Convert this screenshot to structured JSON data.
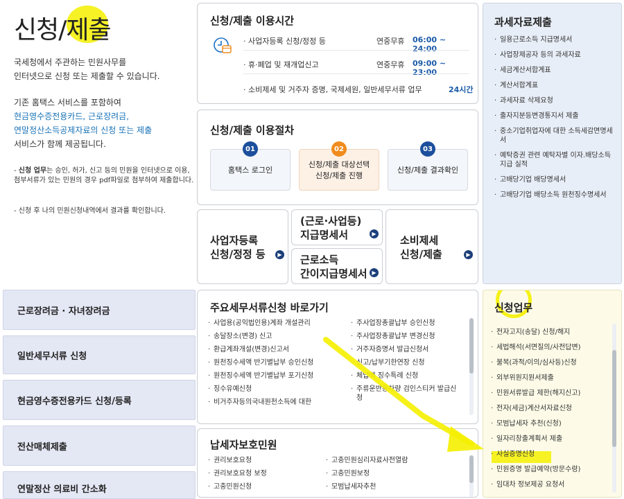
{
  "page_title": "신청/제출",
  "intro": {
    "line1": "국세청에서 주관하는 민원사무를",
    "line2": "인터넷으로 신청 또는 제출할 수 있습니다.",
    "line3": "기존 홈택스 서비스를 포함하여",
    "line4_blue": "현금영수증전용카드, 근로장려금,",
    "line5_blue": "연말정산소득공제자료의 신청 또는 제출",
    "line6": "서비스가 함께 제공됩니다."
  },
  "notes": {
    "note1_bold": "신청 업무",
    "note1_rest": "는 승인, 허가, 신고 등의 민원을 인터넷으로 이용, 첨부서류가 있는 민원의 경우 pdf파일로 첨부하여 제출합니다.",
    "note2": "- 신청 후 나의 민원신청내역에서 결과를 확인합니다."
  },
  "hours": {
    "title": "신청/제출 이용시간",
    "rows": [
      {
        "label": "· 사업자등록 신청/정정 등",
        "days": "연중무휴",
        "time": "06:00 ~ 24:00"
      },
      {
        "label": "· 휴·폐업 및 재개업신고",
        "days": "연중무휴",
        "time": "09:00 ~ 23:00"
      },
      {
        "label": "· 소비제세 및 거주자 증명, 국제세원, 일반세무서류 업무",
        "days": "",
        "time": "24시간"
      }
    ]
  },
  "procedure": {
    "title": "신청/제출 이용절차",
    "steps": [
      {
        "num": "01",
        "label": "홈택스 로그인"
      },
      {
        "num": "02",
        "label": "신청/제출 대상선택\n신청/제출 진행"
      },
      {
        "num": "03",
        "label": "신청/제출 결과확인"
      }
    ]
  },
  "shortcuts": {
    "biz_reg": "사업자등록\n신청/정정 등",
    "pay_stmt": "(근로·사업등)\n지급명세서",
    "simple_stmt": "근로소득\n간이지급명세서",
    "consumption": "소비제세\n신청/제출"
  },
  "tax_submit": {
    "title": "과세자료제출",
    "items": [
      "일용근로소득 지급명세서",
      "사업장제공자 등의 과세자료",
      "세금계산서합계표",
      "계산서합계표",
      "과세자료 삭제요청",
      "출자지분등변경통지서 제출",
      "중소기업취업자에 대한 소득세감면명세서",
      "예탁증권 관련 예탁자별 이자.배당소득 지급 실적",
      "고배당기업 배당명세서",
      "고배당기업 배당소득 원천징수명세서"
    ]
  },
  "side_buttons": [
    "근로장려금 · 자녀장려금",
    "일반세무서류 신청",
    "현금영수증전용카드 신청/등록",
    "전산매체제출",
    "연말정산 의료비 간소화"
  ],
  "main_docs": {
    "title": "주요세무서류신청 바로가기",
    "col1": [
      "사업용(공익법인용)계좌 개설관리",
      "송달장소(변경) 신고",
      "환급계좌개설(변경)신고서",
      "원천징수세액 반기별납부 승인신청",
      "원천징수세액 반기별납부 포기신청",
      "징수유예신청",
      "비거주자등의국내원천소득에 대한"
    ],
    "col2": [
      "주사업장총괄납부 승인신청",
      "주사업장총괄납부 변경신청",
      "거주자증명서 발급신청서",
      "신고/납부기한연장 신청",
      "체납액 징수특례 신청",
      "주류운반용차량 검인스티커 발급신청"
    ]
  },
  "protection": {
    "title": "납세자보호민원",
    "col1": [
      "권리보호요청",
      "권리보호요청 보정",
      "고충민원신청"
    ],
    "col2": [
      "고충민원심리자료사전열람",
      "고충민원보정",
      "모범납세자추천"
    ]
  },
  "apply_work": {
    "title": "신청업무",
    "items": [
      "전자고지(송달) 신청/해지",
      "세법해석(서면질의/사전답변)",
      "불복(과적/이의/심사등)신청",
      "외부위원지원서제출",
      "민원서류발급 제한(해지신고)",
      "전자(세금)계산서자료신청",
      "모범납세자 추천(신청)",
      "일자리창출계획서 제출",
      "사실증명신청",
      "민원증명 발급예약(방문수령)",
      "임대차 정보제공 요청서"
    ]
  },
  "colors": {
    "highlight": "#f5f000",
    "accent_blue": "#1c4f9c",
    "accent_orange": "#f08c1e"
  },
  "icons": [
    "clock-calendar-icon",
    "arrow-right-circle-icon"
  ]
}
